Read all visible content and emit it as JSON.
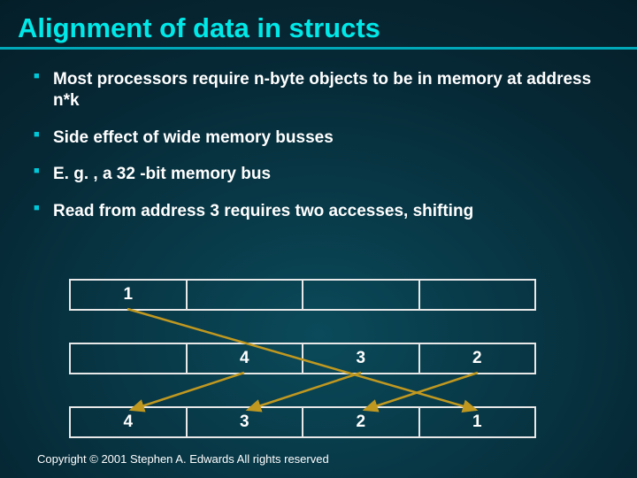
{
  "title": "Alignment of data in structs",
  "bullets": [
    "Most processors require n-byte objects to be in memory at address n*k",
    "Side effect of wide memory busses",
    "E. g. , a 32 -bit memory bus",
    "Read from address 3 requires two accesses, shifting"
  ],
  "diagram": {
    "row1": [
      "1",
      "",
      "",
      ""
    ],
    "row2": [
      "",
      "4",
      "3",
      "2"
    ],
    "row3": [
      "4",
      "3",
      "2",
      "1"
    ]
  },
  "footer": "Copyright © 2001 Stephen A. Edwards  All rights reserved",
  "arrow_color": "#c09820"
}
